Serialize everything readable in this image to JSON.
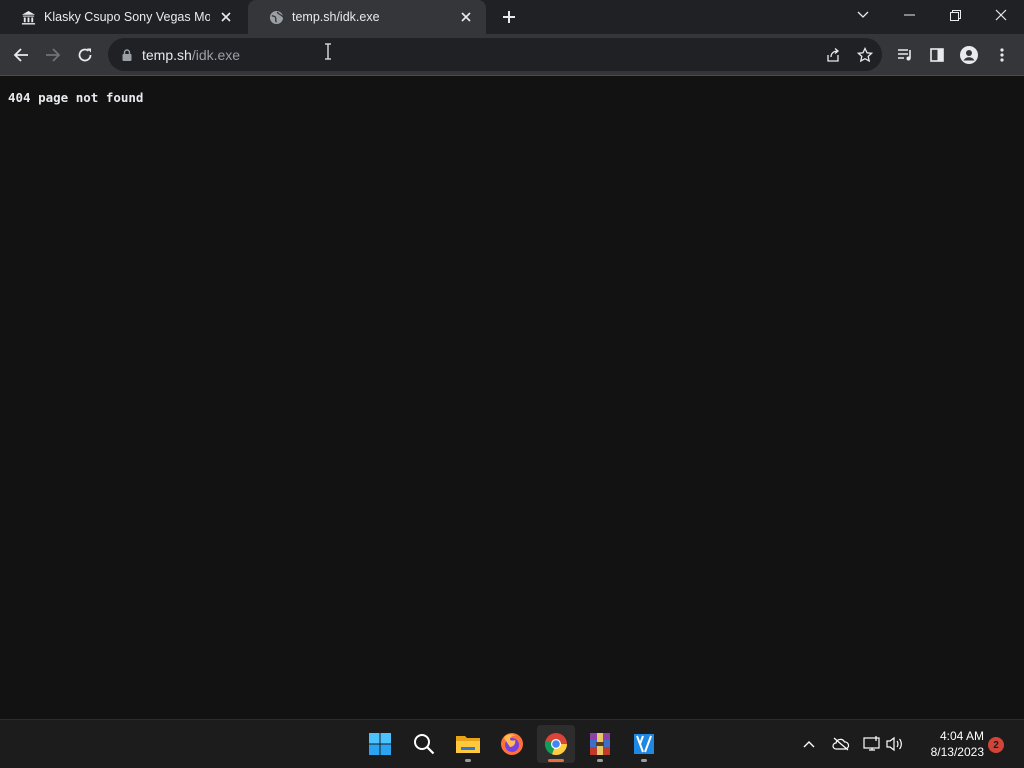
{
  "browser": {
    "tabs": [
      {
        "title": "Klasky Csupo Sony Vegas Movie",
        "favicon": "museum-icon",
        "active": false
      },
      {
        "title": "temp.sh/idk.exe",
        "favicon": "globe-icon",
        "active": true
      }
    ],
    "address": {
      "host": "temp.sh",
      "path": "/idk.exe"
    }
  },
  "page": {
    "body_text": "404 page not found"
  },
  "taskbar": {
    "apps": [
      "start-icon",
      "search-icon",
      "file-explorer-icon",
      "firefox-icon",
      "chrome-icon",
      "winrar-icon",
      "app-icon"
    ],
    "clock": {
      "time": "4:04 AM",
      "date": "8/13/2023"
    },
    "notification_count": "2"
  },
  "colors": {
    "accent": "#e3703e",
    "page_bg": "#121212",
    "toolbar": "#35363a",
    "tabstrip": "#202124",
    "badge": "#d1443a"
  }
}
